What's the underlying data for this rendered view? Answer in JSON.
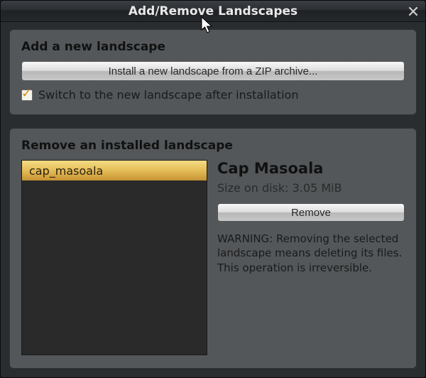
{
  "window": {
    "title": "Add/Remove Landscapes"
  },
  "add_section": {
    "heading": "Add a new landscape",
    "install_button": "Install a new landscape from a ZIP archive...",
    "switch_checkbox_label": "Switch to the new landscape after installation",
    "switch_checked": true
  },
  "remove_section": {
    "heading": "Remove an installed landscape",
    "items": [
      {
        "id": "cap_masoala",
        "label": "cap_masoala",
        "selected": true
      }
    ],
    "selected": {
      "title": "Cap Masoala",
      "size_label": "Size on disk: 3.05 MiB",
      "remove_button": "Remove",
      "warning": "WARNING: Removing the selected landscape means deleting its files. This operation is irreversible."
    }
  }
}
